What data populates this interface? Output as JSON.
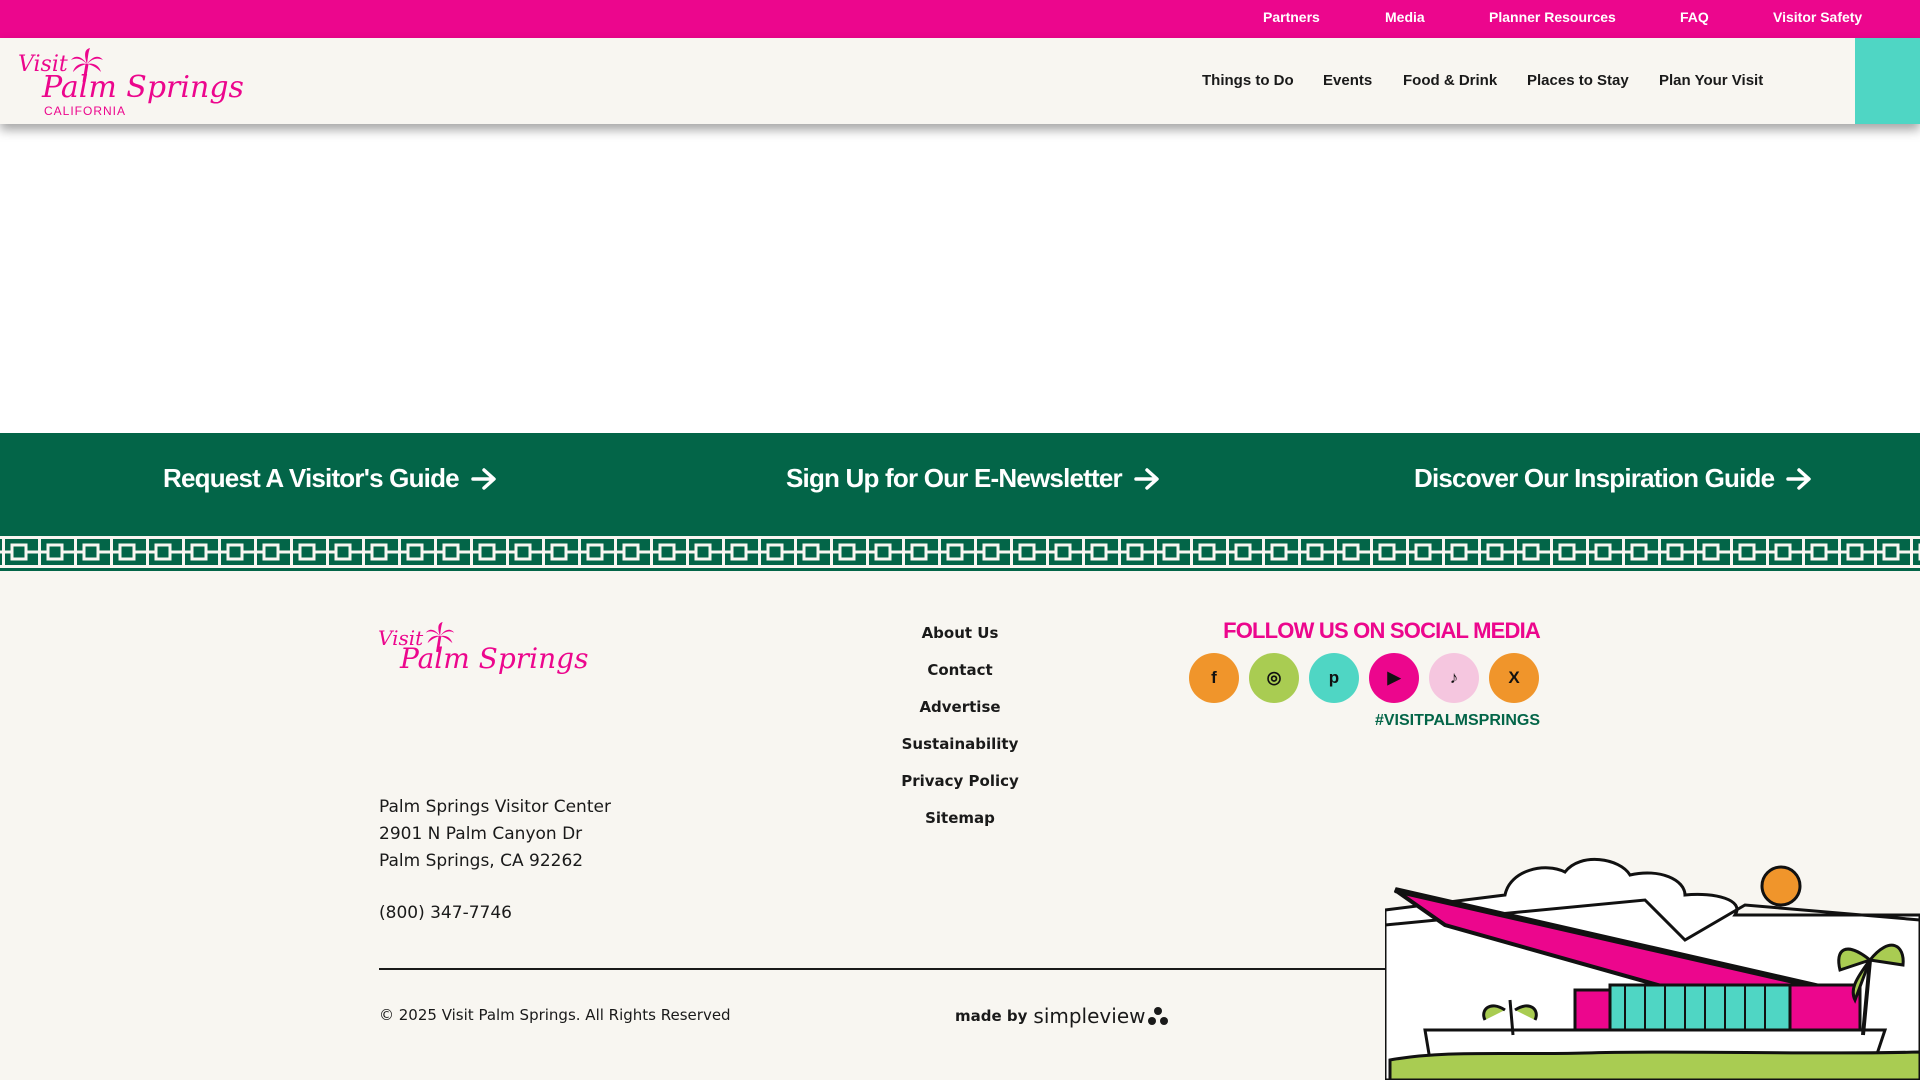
{
  "topbar": {
    "links": [
      "Partners",
      "Media",
      "Planner Resources",
      "FAQ",
      "Visitor Safety"
    ]
  },
  "header": {
    "logo": {
      "visit": "Visit",
      "main": "Palm Springs",
      "sub": "CALIFORNIA"
    },
    "nav": [
      "Things to Do",
      "Events",
      "Food & Drink",
      "Places to Stay",
      "Plan Your Visit"
    ]
  },
  "cta": {
    "visitors_guide": "Request A Visitor's Guide",
    "newsletter": "Sign Up for Our E-Newsletter",
    "inspiration": "Discover Our Inspiration Guide"
  },
  "footer": {
    "logo": {
      "visit": "Visit",
      "main": "Palm Springs"
    },
    "address": [
      "Palm Springs Visitor Center",
      "2901 N Palm Canyon Dr",
      "Palm Springs, CA 92262"
    ],
    "phone": "(800) 347-7746",
    "links": [
      "About Us",
      "Contact",
      "Advertise",
      "Sustainability",
      "Privacy Policy",
      "Sitemap"
    ],
    "social_title": "FOLLOW US ON SOCIAL MEDIA",
    "social": [
      {
        "icon": "facebook-icon",
        "glyph": "f",
        "color": "#f0952b"
      },
      {
        "icon": "instagram-icon",
        "glyph": "◎",
        "color": "#a9cc52"
      },
      {
        "icon": "pinterest-icon",
        "glyph": "p",
        "color": "#4fd6c4"
      },
      {
        "icon": "youtube-icon",
        "glyph": "▶",
        "color": "#ec068d"
      },
      {
        "icon": "tiktok-icon",
        "glyph": "♪",
        "color": "#f5c6df"
      },
      {
        "icon": "x-icon",
        "glyph": "X",
        "color": "#f0952b"
      }
    ],
    "hashtag": "#VISITPALMSPRINGS",
    "copyright": "© 2025 Visit Palm Springs. All Rights Reserved",
    "made_by": "made by",
    "made_by_brand": "simpleview"
  },
  "colors": {
    "brand_pink": "#ec068d",
    "brand_green": "#036548",
    "accent_teal": "#4fd6c4",
    "accent_orange": "#f0952b",
    "accent_lime": "#a9cc52",
    "footer_bg": "#f8f6f1"
  }
}
